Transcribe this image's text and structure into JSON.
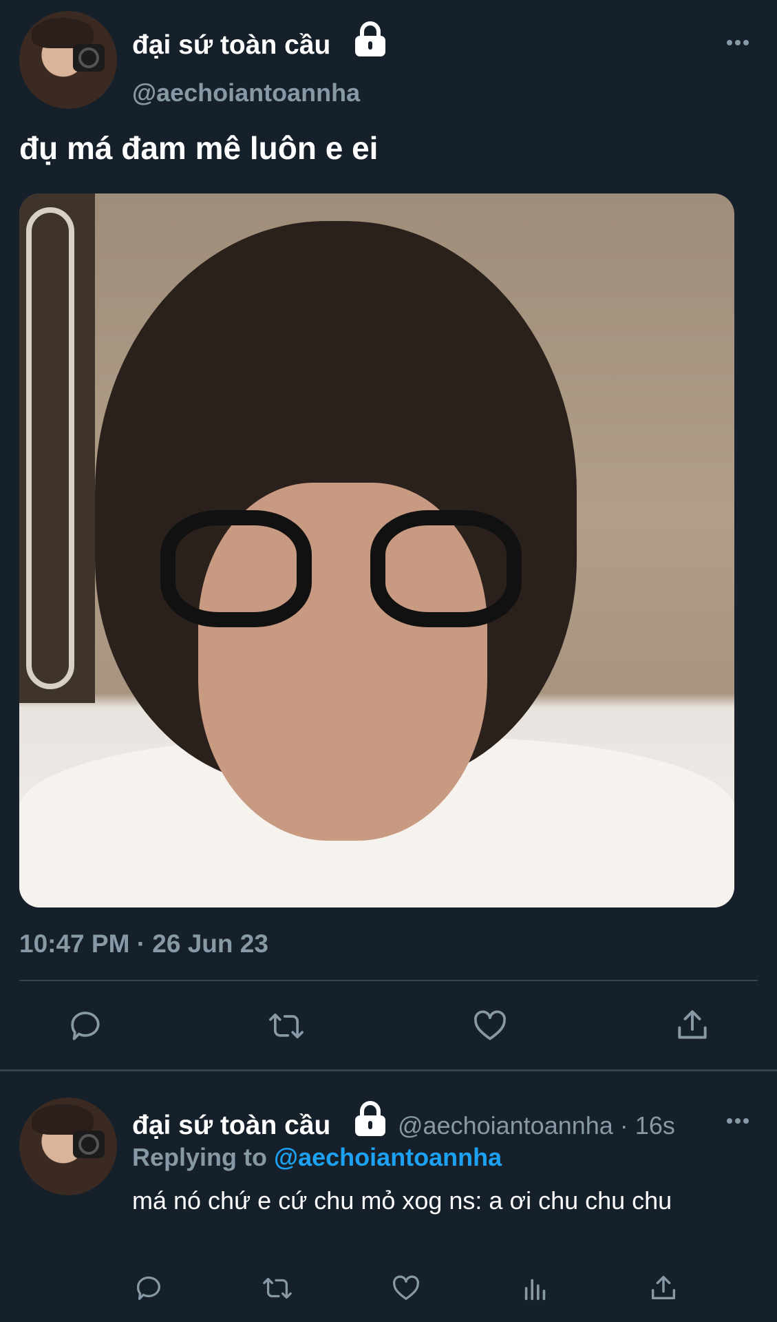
{
  "main_tweet": {
    "display_name": "đại sứ toàn cầu",
    "handle": "@aechoiantoannha",
    "text": "đụ má đam mê luôn e ei",
    "timestamp": "10:47 PM · 26 Jun 23",
    "icons": {
      "verified_lock": "lock-icon",
      "more": "more-icon",
      "actions": [
        "reply-icon",
        "retweet-icon",
        "like-icon",
        "share-icon"
      ]
    }
  },
  "reply_tweet": {
    "display_name": "đại sứ toàn cầu",
    "handle_time": "@aechoiantoannha · 16s",
    "replying_prefix": "Replying to",
    "replying_mention": "@aechoiantoannha",
    "text": "má nó chứ e cứ chu mỏ xog ns: a ơi chu chu chu",
    "icons": {
      "actions": [
        "reply-icon",
        "retweet-icon",
        "like-icon",
        "analytics-icon",
        "share-icon"
      ]
    }
  },
  "colors": {
    "background": "#15202b",
    "divider": "#38444d",
    "secondary_text": "#8899a6",
    "link": "#1da1f2",
    "icon": "#8899a6"
  }
}
